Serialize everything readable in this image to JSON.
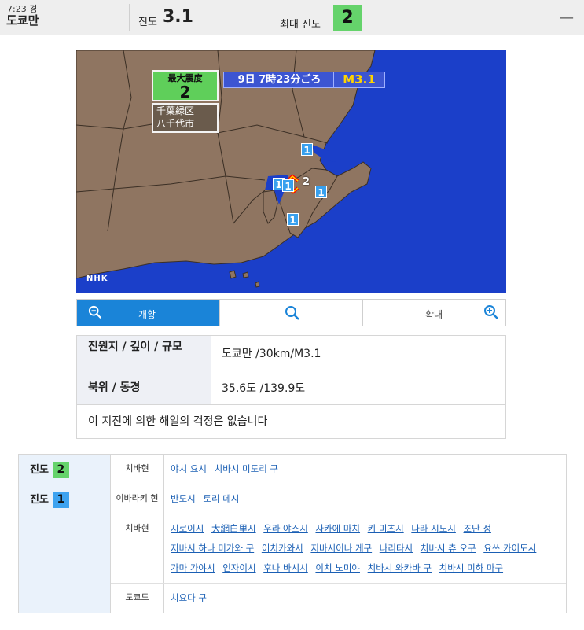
{
  "header": {
    "time": "7:23 경",
    "region": "도쿄만",
    "intensity_label": "진도",
    "intensity_value": "3.1",
    "max_intensity_label": "최대 진도",
    "max_intensity_value": "2",
    "collapse_icon": "minus-icon"
  },
  "map": {
    "max_label": "最大震度",
    "max_value": "2",
    "places": [
      "千葉緑区",
      "八千代市"
    ],
    "time_text": "9日 7時23分ごろ",
    "magnitude_text": "M3.1",
    "logo_text": "NHK",
    "points": [
      "1",
      "1",
      "1",
      "1",
      "1",
      "2"
    ]
  },
  "zoombar": {
    "zoom_out_label": "개황",
    "zoom_in_label": "확대",
    "icons": [
      "zoom-out-icon",
      "search-icon",
      "zoom-in-icon"
    ],
    "active_color": "#1a84d8"
  },
  "info": {
    "rows": [
      {
        "key": "진원지 / 깊이 / 규모",
        "value": "도쿄만 /30km/M3.1"
      },
      {
        "key": "북위 / 동경",
        "value": "35.6도 /139.9도"
      }
    ],
    "note": "이 지진에 의한 해일의 걱정은 없습니다"
  },
  "intensity_list": [
    {
      "label": "진도",
      "level": "2",
      "prefectures": [
        {
          "name": "치바현",
          "cities": [
            "야치 요시",
            "치바시 미도리 구"
          ]
        }
      ]
    },
    {
      "label": "진도",
      "level": "1",
      "prefectures": [
        {
          "name": "이바라키 현",
          "cities": [
            "반도시",
            "토리 데시"
          ]
        },
        {
          "name": "치바현",
          "cities": [
            "시로이시",
            "大網白里시",
            "우라 야스시",
            "사카에 마치",
            "키 미츠시",
            "나라 시노시",
            "조난 정",
            "지바시 하나 미가와 구",
            "이치카와시",
            "지바시이나 게구",
            "나리타시",
            "치바시 츄 오구",
            "요쓰 카이도시",
            "가마 가야시",
            "인자이시",
            "후나 바시시",
            "이치 노미야",
            "치바시 와카바 구",
            "치바시 미하 마구"
          ]
        },
        {
          "name": "도쿄도",
          "cities": [
            "치요다 구"
          ]
        }
      ]
    }
  ],
  "colors": {
    "intensity_2": "#65d36b",
    "intensity_1": "#3ea3f0",
    "sea": "#1b3fc9",
    "land": "#8f7561",
    "link": "#1a5fb4"
  }
}
